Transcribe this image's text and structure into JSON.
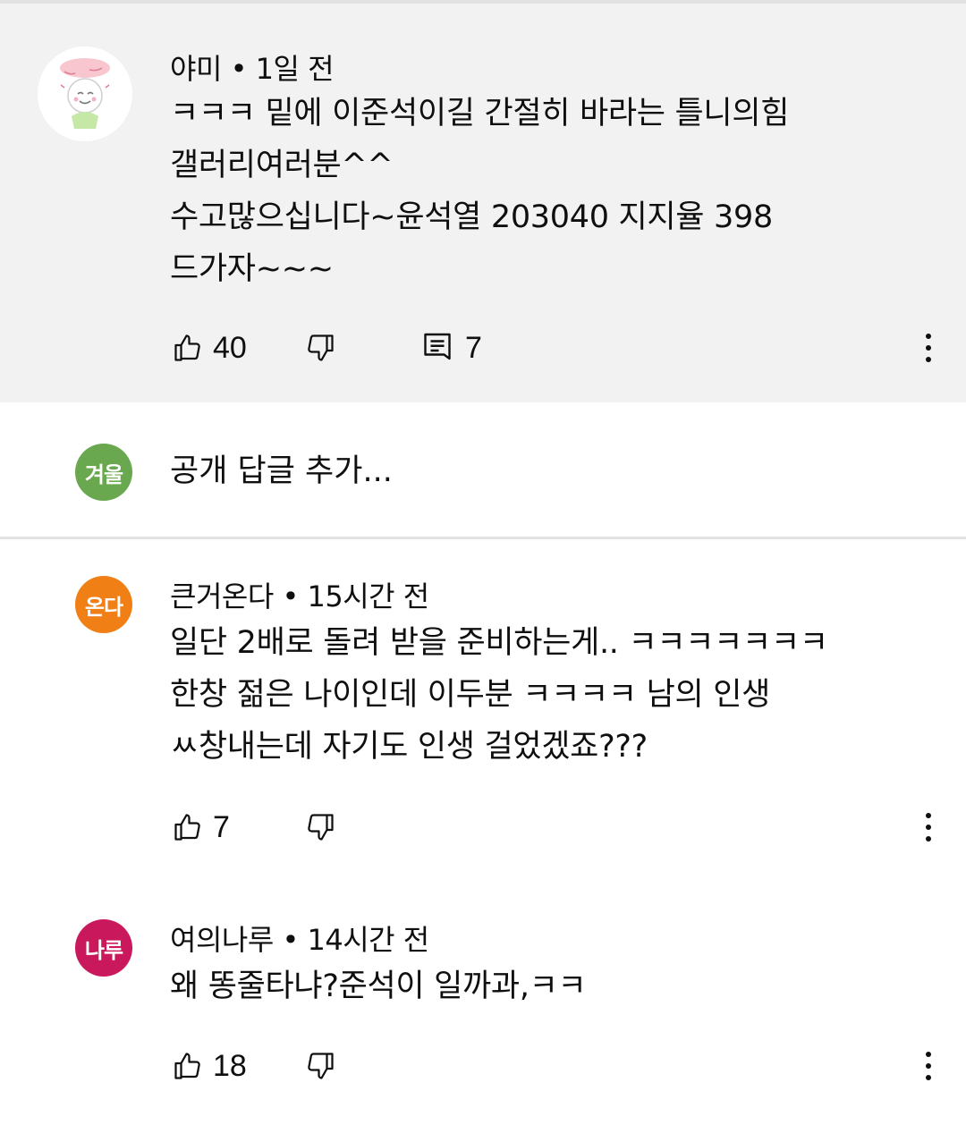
{
  "colors": {
    "pinned_background": "#f2f2f2",
    "avatar_user": "#6aa84f",
    "avatar_c1": "#f07f16",
    "avatar_c2": "#c9185c"
  },
  "pinned_comment": {
    "avatar_icon": "character-avatar-image",
    "author": "야미",
    "time": "1일 전",
    "lines": [
      "ㅋㅋㅋ 밑에 이준석이길 간절히 바라는 틀니의힘",
      "갤러리여러분^^",
      "수고많으십니다~윤석열 203040 지지율 398",
      "드가자~~~"
    ],
    "likes": "40",
    "replies": "7"
  },
  "reply_box": {
    "avatar_text": "겨울",
    "placeholder": "공개 답글 추가..."
  },
  "comments": [
    {
      "avatar_text": "온다",
      "author": "큰거온다",
      "time": "15시간 전",
      "lines": [
        "일단 2배로 돌려 받을 준비하는게.. ㅋㅋㅋㅋㅋㅋㅋ",
        "한창 젊은 나이인데 이두분 ㅋㅋㅋㅋ  남의 인생",
        "ㅆ창내는데 자기도 인생 걸었겠죠???"
      ],
      "likes": "7"
    },
    {
      "avatar_text": "나루",
      "author": "여의나루",
      "time": "14시간 전",
      "lines": [
        "왜 똥줄타냐?준석이 일까과,ㅋㅋ"
      ],
      "likes": "18"
    }
  ],
  "separator": "•"
}
